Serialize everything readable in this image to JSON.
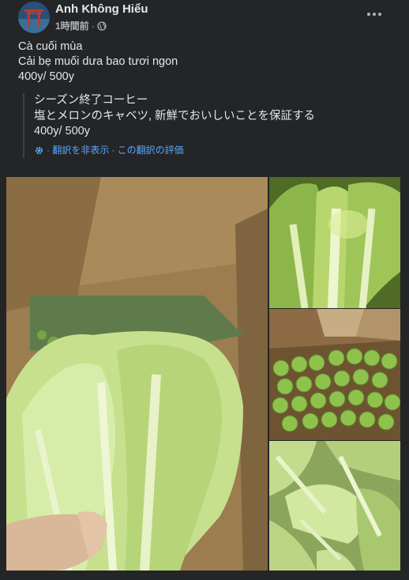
{
  "post": {
    "author": "Anh Không Hiểu",
    "time": "1時間前",
    "separator": "·",
    "audience_icon": "globe-icon",
    "lines": [
      "Cà cuối mùa",
      "Cải bẹ muối dưa bao tươi ngon",
      "400y/ 500y"
    ]
  },
  "translation": {
    "lines": [
      "シーズン終了コーヒー",
      "塩とメロンのキャベツ, 新鮮でおいしいことを保証する",
      "400y/ 500y"
    ],
    "hide_label": "· 翻訳を非表示",
    "rate_label": "· この翻訳の評価",
    "link_color": "#5aa7ff"
  },
  "photos": [
    {
      "subject": "mustard-greens-in-hand"
    },
    {
      "subject": "mustard-greens-closeup"
    },
    {
      "subject": "green-eggplants-in-box"
    },
    {
      "subject": "mustard-greens-pile"
    }
  ],
  "colors": {
    "background": "#242526",
    "text": "#e4e6eb",
    "secondary": "#b0b3b8"
  }
}
